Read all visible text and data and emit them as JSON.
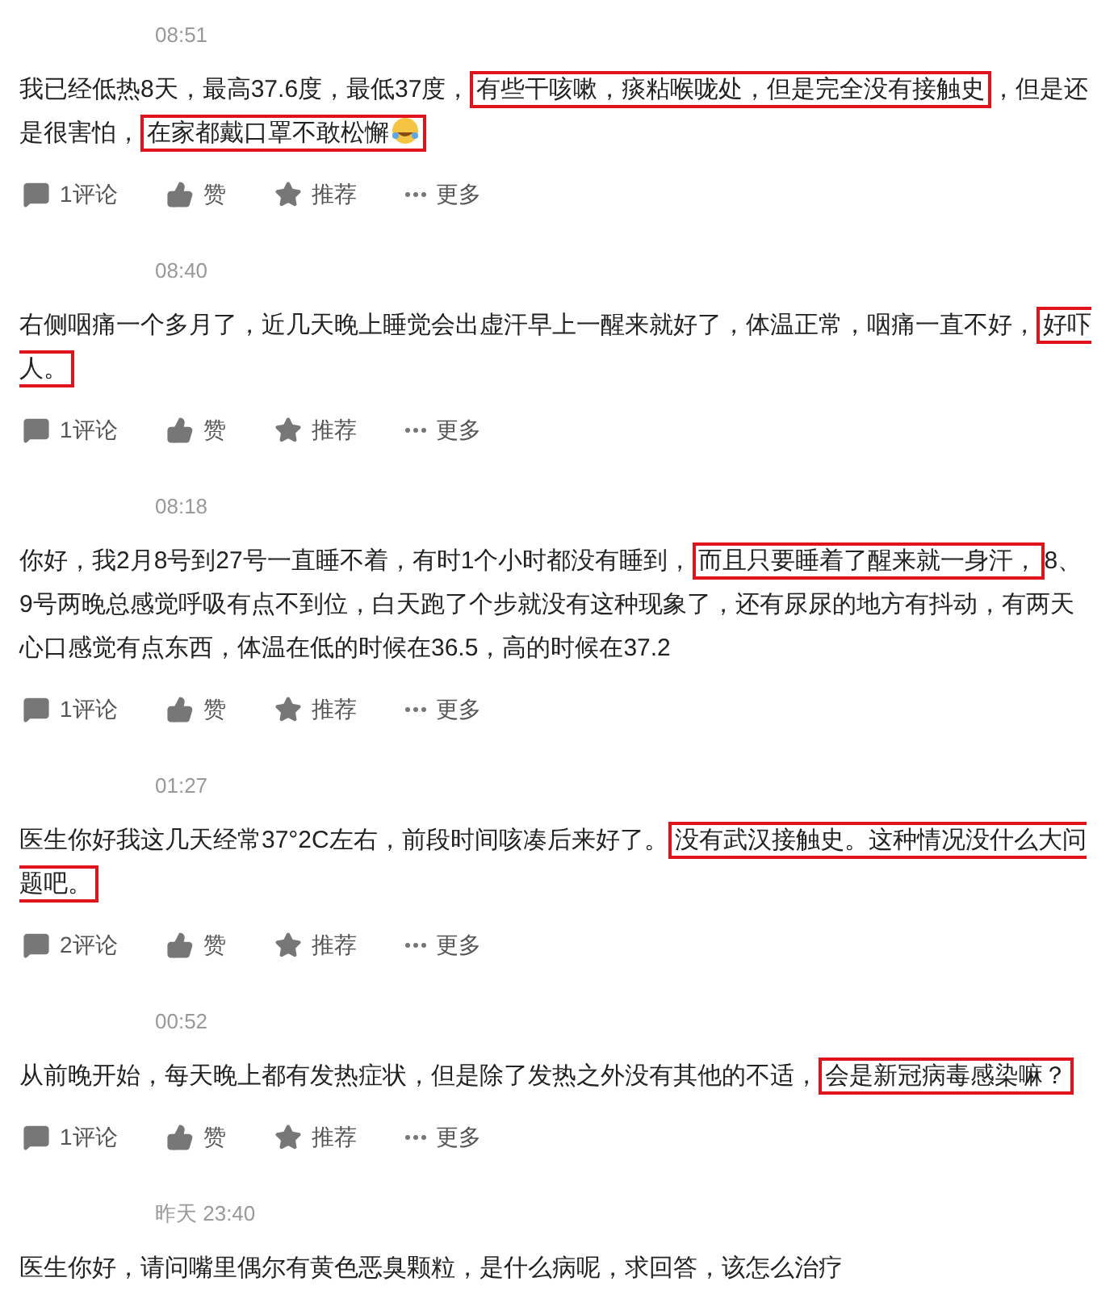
{
  "comments": [
    {
      "time": "08:51",
      "segments": [
        {
          "text": "我已经低热8天，最高37.6度，最低37度，",
          "highlighted": false
        },
        {
          "text": "有些干咳嗽，痰粘喉咙处，但是完全没有接触史",
          "highlighted": true
        },
        {
          "text": "，但是还是很害怕，",
          "highlighted": false
        },
        {
          "text": "在家都戴口罩不敢松懈",
          "highlighted": true,
          "emoji": true
        }
      ],
      "comment_count": "1评论",
      "like": "赞",
      "recommend": "推荐",
      "more": "更多"
    },
    {
      "time": "08:40",
      "segments": [
        {
          "text": "右侧咽痛一个多月了，近几天晚上睡觉会出虚汗早上一醒来就好了，体温正常，咽痛一直不好，",
          "highlighted": false
        },
        {
          "text": "好吓人。",
          "highlighted": true
        }
      ],
      "comment_count": "1评论",
      "like": "赞",
      "recommend": "推荐",
      "more": "更多"
    },
    {
      "time": "08:18",
      "segments": [
        {
          "text": "你好，我2月8号到27号一直睡不着，有时1个小时都没有睡到，",
          "highlighted": false
        },
        {
          "text": "而且只要睡着了醒来就一身汗，",
          "highlighted": true
        },
        {
          "text": "8、9号两晚总感觉呼吸有点不到位，白天跑了个步就没有这种现象了，还有尿尿的地方有抖动，有两天心口感觉有点东西，体温在低的时候在36.5，高的时候在37.2",
          "highlighted": false
        }
      ],
      "comment_count": "1评论",
      "like": "赞",
      "recommend": "推荐",
      "more": "更多"
    },
    {
      "time": "01:27",
      "segments": [
        {
          "text": "医生你好我这几天经常37°2C左右，前段时间咳凑后来好了。",
          "highlighted": false
        },
        {
          "text": "没有武汉接触史。这种情况没什么大问题吧。",
          "highlighted": true
        }
      ],
      "comment_count": "2评论",
      "like": "赞",
      "recommend": "推荐",
      "more": "更多"
    },
    {
      "time": "00:52",
      "segments": [
        {
          "text": "从前晚开始，每天晚上都有发热症状，但是除了发热之外没有其他的不适，",
          "highlighted": false
        },
        {
          "text": "会是新冠病毒感染嘛？",
          "highlighted": true
        }
      ],
      "comment_count": "1评论",
      "like": "赞",
      "recommend": "推荐",
      "more": "更多"
    },
    {
      "time": "昨天 23:40",
      "segments": [
        {
          "text": "医生你好，请问嘴里偶尔有黄色恶臭颗粒，是什么病呢，求回答，该怎么治疗",
          "highlighted": false
        }
      ]
    }
  ]
}
